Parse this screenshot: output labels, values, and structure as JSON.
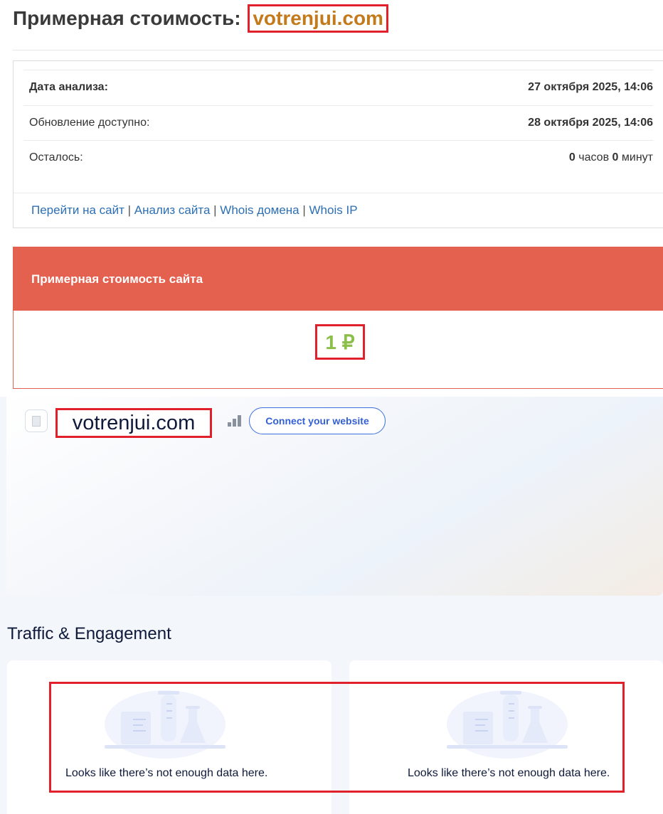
{
  "header": {
    "title_prefix": "Примерная стоимость:",
    "domain": "votrenjui.com"
  },
  "info": {
    "rows": [
      {
        "label": "Дата анализа:",
        "value": "27 октября 2025, 14:06"
      },
      {
        "label": "Обновление доступно:",
        "value": "28 октября 2025, 14:06"
      }
    ],
    "remaining": {
      "label": "Осталось:",
      "hours": "0",
      "hours_unit": "часов",
      "minutes": "0",
      "minutes_unit": "минут"
    },
    "links": [
      "Перейти на сайт",
      "Анализ сайта",
      "Whois домена",
      "Whois IP"
    ],
    "separator": "|"
  },
  "cost": {
    "header": "Примерная стоимость сайта",
    "value": "1 ₽"
  },
  "similarweb": {
    "site": "votrenjui.com",
    "connect_label": "Connect your website",
    "section_title": "Traffic & Engagement",
    "nodata_text": "Looks like there’s not enough data here."
  },
  "icons": [
    "file-icon",
    "rank-bars-icon",
    "lab-illustration-icon"
  ],
  "colors": {
    "accent_red": "#e4604f",
    "price_green": "#8cbf4a",
    "link_blue": "#2d6fb3",
    "domain_orange": "#c27a1a",
    "highlight_red": "#e0212b"
  }
}
